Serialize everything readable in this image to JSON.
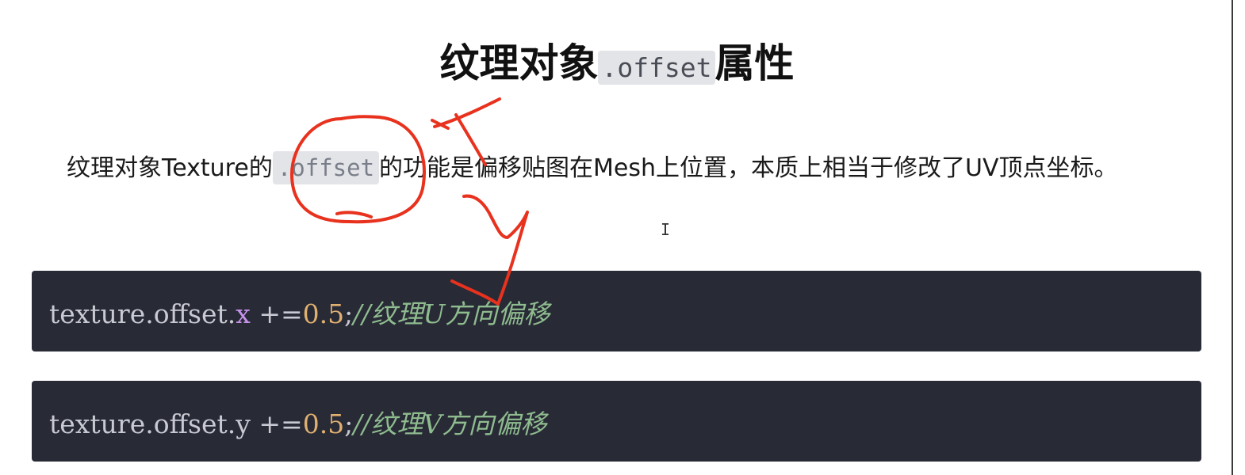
{
  "title": {
    "prefix": "纹理对象",
    "code": ".offset",
    "suffix": "属性"
  },
  "paragraph": {
    "before": "纹理对象Texture的",
    "code": ".offset",
    "after": "的功能是偏移贴图在Mesh上位置，本质上相当于修改了UV顶点坐标。"
  },
  "code_blocks": [
    {
      "object": "texture.offset.",
      "property": "x",
      "operator": " +=",
      "number": "0.5",
      "semicolon": ";",
      "comment": "//纹理U方向偏移"
    },
    {
      "object": "texture.offset.",
      "property": "y",
      "operator": " +=",
      "number": "0.5",
      "semicolon": ";",
      "comment": "//纹理V方向偏移"
    }
  ],
  "colors": {
    "code_bg": "#282a36",
    "inline_code_bg": "#e2e4e8",
    "annotation": "#e8321e"
  }
}
